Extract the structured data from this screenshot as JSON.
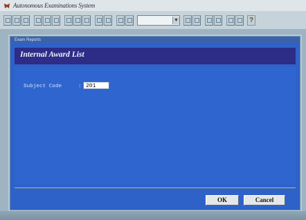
{
  "app": {
    "title": "Autonomous Examinations System",
    "icon": "app-logo-icon"
  },
  "toolbar": {
    "combo_value": "",
    "help_icon": "help-icon"
  },
  "dialog": {
    "caption": "Exam Reports",
    "banner_title": "Internal Award List",
    "subject_code_label": "Subject Code",
    "subject_code_separator": ":",
    "subject_code_value": "201",
    "ok_label": "OK",
    "cancel_label": "Cancel"
  },
  "colors": {
    "banner": "#2d2c86",
    "form_background": "#2f65cf",
    "divider": "#c7b968"
  }
}
